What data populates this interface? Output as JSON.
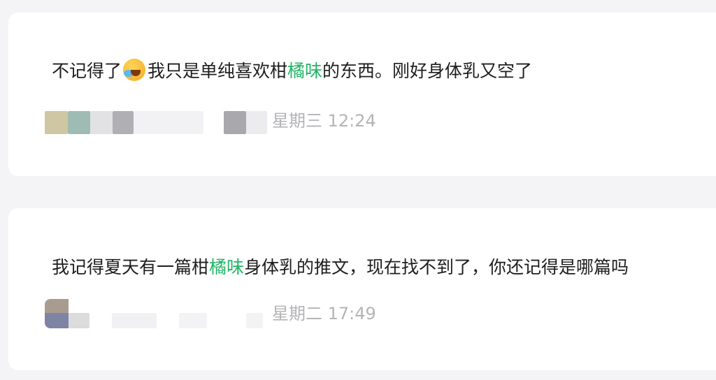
{
  "messages": [
    {
      "before": "不记得了",
      "emoji_icon": "laughing-crying-emoji-icon",
      "text_a": "我只是单纯喜欢柑",
      "highlight": "橘味",
      "text_b": "的东西。刚好身体乳又空了",
      "timestamp": "星期三 12:24"
    },
    {
      "text_a": "我记得夏天有一篇柑",
      "highlight": "橘味",
      "text_b": "身体乳的推文，现在找不到了，你还记得是哪篇吗",
      "timestamp": "星期二 17:49"
    }
  ],
  "colors": {
    "background": "#f4f4f6",
    "card": "#ffffff",
    "text": "#1e1e1e",
    "highlight": "#21b464",
    "meta": "#b4b4b8"
  }
}
